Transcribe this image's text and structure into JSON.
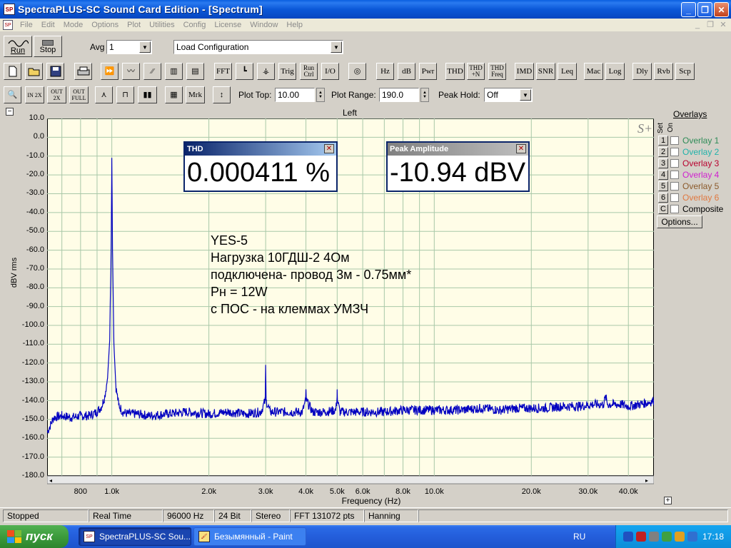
{
  "window": {
    "title": "SpectraPLUS-SC Sound Card Edition - [Spectrum]"
  },
  "menu": [
    "File",
    "Edit",
    "Mode",
    "Options",
    "Plot",
    "Utilities",
    "Config",
    "License",
    "Window",
    "Help"
  ],
  "toolbar1": {
    "run_label": "Run",
    "stop_label": "Stop",
    "avg_label": "Avg",
    "avg_value": "1",
    "config_value": "Load Configuration"
  },
  "toolbar2": {
    "buttons": [
      "FFT",
      "Trig",
      "Run Ctrl",
      "I/O",
      "Hz",
      "dB",
      "Pwr",
      "THD",
      "THD +N",
      "THD Freq",
      "IMD",
      "SNR",
      "Leq",
      "Mac",
      "Log",
      "Dly",
      "Rvb",
      "Scp"
    ]
  },
  "toolbar3": {
    "mrk_label": "Mrk",
    "plot_top_label": "Plot Top:",
    "plot_top_value": "10.00",
    "plot_range_label": "Plot Range:",
    "plot_range_value": "190.0",
    "peak_hold_label": "Peak Hold:",
    "peak_hold_value": "Off",
    "zoom_labels": [
      "IN 2X",
      "OUT 2X",
      "OUT FULL"
    ]
  },
  "chart_header": {
    "channel": "Left",
    "logo": "S+"
  },
  "meters": {
    "thd": {
      "title": "THD",
      "value": "0.000411 %"
    },
    "peak": {
      "title": "Peak Amplitude",
      "value": "-10.94 dBV"
    }
  },
  "annotation": [
    "YES-5",
    "Нагрузка  10ГДШ-2  4Ом",
    "подключена- провод 3м - 0.75мм*",
    "Рн = 12W",
    "с ПОС - на клеммах УМЗЧ"
  ],
  "overlays": {
    "title": "Overlays",
    "set_label": "Set",
    "on_label": "On",
    "items": [
      {
        "set": "1",
        "label": "Overlay 1",
        "color": "#2e8b57"
      },
      {
        "set": "2",
        "label": "Overlay 2",
        "color": "#20b2aa"
      },
      {
        "set": "3",
        "label": "Overlay 3",
        "color": "#b8002e"
      },
      {
        "set": "4",
        "label": "Overlay 4",
        "color": "#d020d0"
      },
      {
        "set": "5",
        "label": "Overlay 5",
        "color": "#8b5a2b"
      },
      {
        "set": "6",
        "label": "Overlay 6",
        "color": "#e07840"
      },
      {
        "set": "C",
        "label": "Composite",
        "color": "#000000"
      }
    ],
    "options_label": "Options..."
  },
  "status": [
    "Stopped",
    "Real Time",
    "96000 Hz",
    "24 Bit",
    "Stereo",
    "FFT 131072 pts",
    "Hanning"
  ],
  "taskbar": {
    "start_label": "пуск",
    "tasks": [
      "SpectraPLUS-SC Sou...",
      "Безымянный - Paint"
    ],
    "lang": "RU",
    "time": "17:18"
  },
  "chart_data": {
    "type": "line",
    "title": "",
    "xlabel": "Frequency (Hz)",
    "ylabel": "dBV rms",
    "x_scale": "log",
    "xlim": [
      630,
      48000
    ],
    "ylim": [
      -180,
      10
    ],
    "y_ticks": [
      "10.0",
      "0.0",
      "-10.0",
      "-20.0",
      "-30.0",
      "-40.0",
      "-50.0",
      "-60.0",
      "-70.0",
      "-80.0",
      "-90.0",
      "-100.0",
      "-110.0",
      "-120.0",
      "-130.0",
      "-140.0",
      "-150.0",
      "-160.0",
      "-170.0",
      "-180.0"
    ],
    "x_ticks": [
      {
        "value": 800,
        "label": "800"
      },
      {
        "value": 1000,
        "label": "1.0k"
      },
      {
        "value": 2000,
        "label": "2.0k"
      },
      {
        "value": 3000,
        "label": "3.0k"
      },
      {
        "value": 4000,
        "label": "4.0k"
      },
      {
        "value": 5000,
        "label": "5.0k"
      },
      {
        "value": 6000,
        "label": "6.0k"
      },
      {
        "value": 8000,
        "label": "8.0k"
      },
      {
        "value": 10000,
        "label": "10.0k"
      },
      {
        "value": 20000,
        "label": "20.0k"
      },
      {
        "value": 30000,
        "label": "30.0k"
      },
      {
        "value": 40000,
        "label": "40.0k"
      }
    ],
    "grid": true,
    "series": [
      {
        "color": "#0000c0",
        "x": [
          630,
          660,
          700,
          750,
          800,
          850,
          900,
          930,
          950,
          970,
          985,
          995,
          1000,
          1005,
          1015,
          1030,
          1050,
          1080,
          1120,
          1200,
          1300,
          1500,
          1700,
          2000,
          2300,
          2600,
          2900,
          2990,
          3000,
          3010,
          3100,
          3500,
          3900,
          3990,
          4000,
          4010,
          4200,
          4600,
          4950,
          4990,
          5000,
          5010,
          5100,
          6000,
          7000,
          8000,
          9000,
          10000,
          12000,
          14000,
          16000,
          18000,
          19500,
          20000,
          22000,
          25000,
          28000,
          31000,
          33500,
          34000,
          34500,
          36000,
          38000,
          40000,
          43000,
          46000,
          48000
        ],
        "y": [
          -157,
          -149,
          -148,
          -149,
          -148,
          -148,
          -146,
          -143,
          -138,
          -128,
          -108,
          -60,
          -10.94,
          -60,
          -110,
          -133,
          -142,
          -146,
          -147,
          -147,
          -148,
          -147,
          -146,
          -147,
          -146,
          -147,
          -146,
          -140,
          -121,
          -140,
          -146,
          -146,
          -146,
          -140,
          -134,
          -140,
          -146,
          -146,
          -145,
          -140,
          -134,
          -140,
          -146,
          -146,
          -146,
          -145,
          -145,
          -145,
          -145,
          -144,
          -145,
          -144,
          -144,
          -144,
          -144,
          -143,
          -143,
          -142,
          -142,
          -138,
          -142,
          -142,
          -142,
          -143,
          -142,
          -141,
          -140
        ]
      }
    ]
  }
}
